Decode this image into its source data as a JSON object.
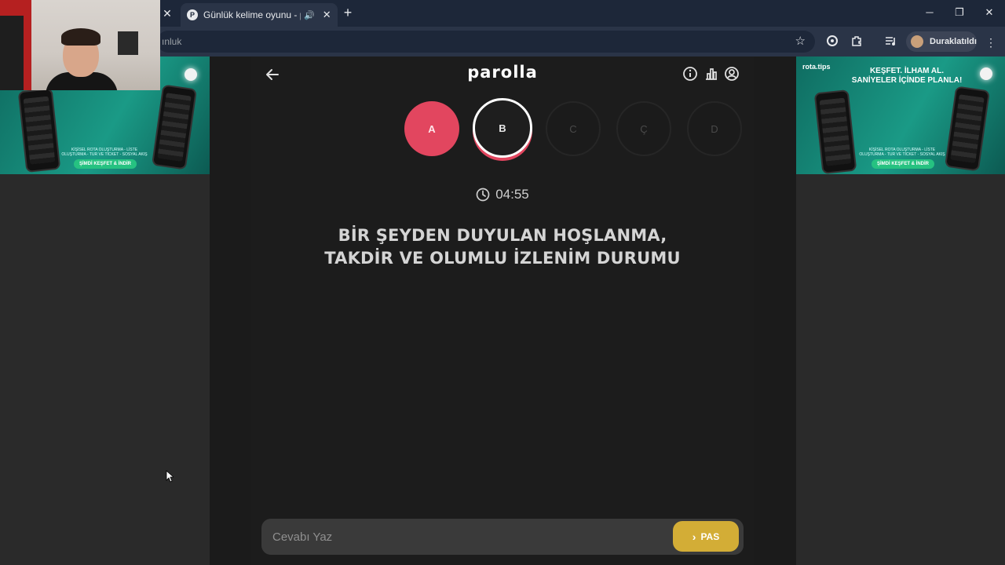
{
  "browser": {
    "tab_title": "Günlük kelime oyunu - parc",
    "favicon_letter": "P",
    "new_tab": "+",
    "address": "ınluk",
    "profile_name": "Duraklatıldı"
  },
  "ads": {
    "brand": "rota.tips",
    "headline_line1": "KEŞFET. İLHAM AL.",
    "headline_line2": "SANİYELER İÇİNDE PLANLA!",
    "tagline": "KİŞİSEL ROTA OLUŞTURMA - LİSTE OLUŞTURMA - TUR VE TİCKET - SOSYAL AKIŞ",
    "cta": "ŞİMDİ KEŞFET & İNDİR"
  },
  "game": {
    "logo": "parolla",
    "letters": [
      {
        "letter": "A",
        "state": "done"
      },
      {
        "letter": "B",
        "state": "active"
      },
      {
        "letter": "C",
        "state": "pending"
      },
      {
        "letter": "Ç",
        "state": "pending"
      },
      {
        "letter": "D",
        "state": "pending"
      }
    ],
    "timer": "04:55",
    "question_line1": "BİR ŞEYDEN DUYULAN HOŞLANMA,",
    "question_line2": "TAKDİR VE OLUMLU İZLENİM DURUMU",
    "answer_placeholder": "Cevabı Yaz",
    "pass_label": "PAS"
  },
  "colors": {
    "accent_red": "#e2465f",
    "pass_yellow": "#d3ad36",
    "ad_green": "#1a9a86"
  }
}
